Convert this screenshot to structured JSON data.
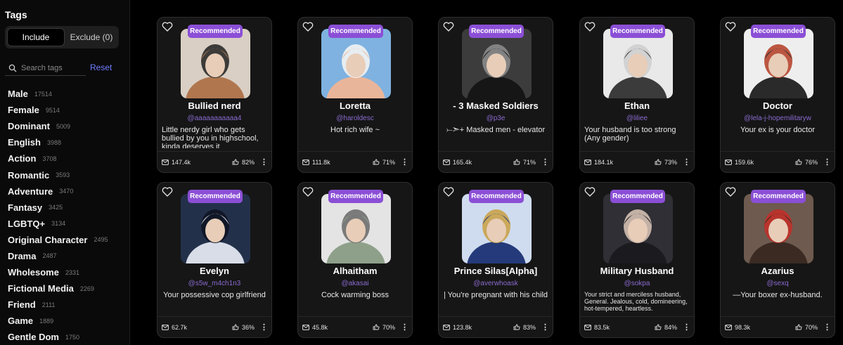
{
  "sidebar": {
    "title": "Tags",
    "include_label": "Include",
    "exclude_label": "Exclude (0)",
    "search_placeholder": "Search tags",
    "reset_label": "Reset",
    "tags": [
      {
        "name": "Male",
        "count": "17514"
      },
      {
        "name": "Female",
        "count": "9514"
      },
      {
        "name": "Dominant",
        "count": "5009"
      },
      {
        "name": "English",
        "count": "3988"
      },
      {
        "name": "Action",
        "count": "3708"
      },
      {
        "name": "Romantic",
        "count": "3593"
      },
      {
        "name": "Adventure",
        "count": "3470"
      },
      {
        "name": "Fantasy",
        "count": "3425"
      },
      {
        "name": "LGBTQ+",
        "count": "3134"
      },
      {
        "name": "Original Character",
        "count": "2495"
      },
      {
        "name": "Drama",
        "count": "2487"
      },
      {
        "name": "Wholesome",
        "count": "2331"
      },
      {
        "name": "Fictional Media",
        "count": "2269"
      },
      {
        "name": "Friend",
        "count": "2111"
      },
      {
        "name": "Game",
        "count": "1889"
      },
      {
        "name": "Gentle Dom",
        "count": "1750"
      }
    ]
  },
  "badge_label": "Recommended",
  "cards": [
    {
      "name": "Bullied nerd",
      "handle": "@aaaaaaaaaaa4",
      "desc": "Little nerdy girl who gets bullied by you in highschool, kinda deserves it",
      "messages": "147.4k",
      "rating": "82%",
      "colors": {
        "bg": "#d9cfc4",
        "main": "#b0764e",
        "accent": "#2a2a2a"
      }
    },
    {
      "name": "Loretta",
      "handle": "@haroldesc",
      "desc": "Hot rich wife ~",
      "messages": "111.8k",
      "rating": "71%",
      "colors": {
        "bg": "#7fb2e0",
        "main": "#e9b59a",
        "accent": "#f3f3f3"
      }
    },
    {
      "name": "- 3 Masked Soldiers",
      "handle": "@p3e",
      "desc": "⤚➣+ Masked men - elevator",
      "messages": "165.4k",
      "rating": "71%",
      "colors": {
        "bg": "#3c3c3c",
        "main": "#161616",
        "accent": "#8a8a8a"
      }
    },
    {
      "name": "Ethan",
      "handle": "@liliee",
      "desc": "Your husband is too strong (Any gender)",
      "messages": "184.1k",
      "rating": "73%",
      "colors": {
        "bg": "#e9e9e9",
        "main": "#3b3b3b",
        "accent": "#cfcfcf"
      }
    },
    {
      "name": "Doctor",
      "handle": "@lela-j-hopemilitaryw",
      "desc": "Your ex is your doctor",
      "messages": "159.6k",
      "rating": "76%",
      "colors": {
        "bg": "#eeeeee",
        "main": "#2a2a2a",
        "accent": "#b6452f"
      }
    },
    {
      "name": "Evelyn",
      "handle": "@s5w_m4ch1n3",
      "desc": "Your possessive cop girlfriend",
      "messages": "62.7k",
      "rating": "36%",
      "colors": {
        "bg": "#23304a",
        "main": "#d8dde8",
        "accent": "#0f1524"
      }
    },
    {
      "name": "Alhaitham",
      "handle": "@akasai",
      "desc": "Cock warming boss",
      "messages": "45.8k",
      "rating": "70%",
      "colors": {
        "bg": "#e4e4e4",
        "main": "#8ea08a",
        "accent": "#6e6e6e"
      }
    },
    {
      "name": "Prince Silas[Alpha]",
      "handle": "@averwhoask",
      "desc": "| You're pregnant with his child",
      "messages": "123.8k",
      "rating": "83%",
      "colors": {
        "bg": "#cfdcef",
        "main": "#243a7a",
        "accent": "#c9a24a"
      }
    },
    {
      "name": "Military Husband",
      "handle": "@sokpa",
      "desc": "Your strict and merciless husband, General. Jealous, cold, domineering, hot-tempered, heartless.",
      "messages": "83.5k",
      "rating": "84%",
      "colors": {
        "bg": "#2f2f35",
        "main": "#1a1a1f",
        "accent": "#d4c0b2"
      }
    },
    {
      "name": "Azarius",
      "handle": "@sexq",
      "desc": "—Your boxer ex-husband.",
      "messages": "98.3k",
      "rating": "70%",
      "colors": {
        "bg": "#6e5a4e",
        "main": "#3a2a22",
        "accent": "#c0302a"
      }
    }
  ]
}
